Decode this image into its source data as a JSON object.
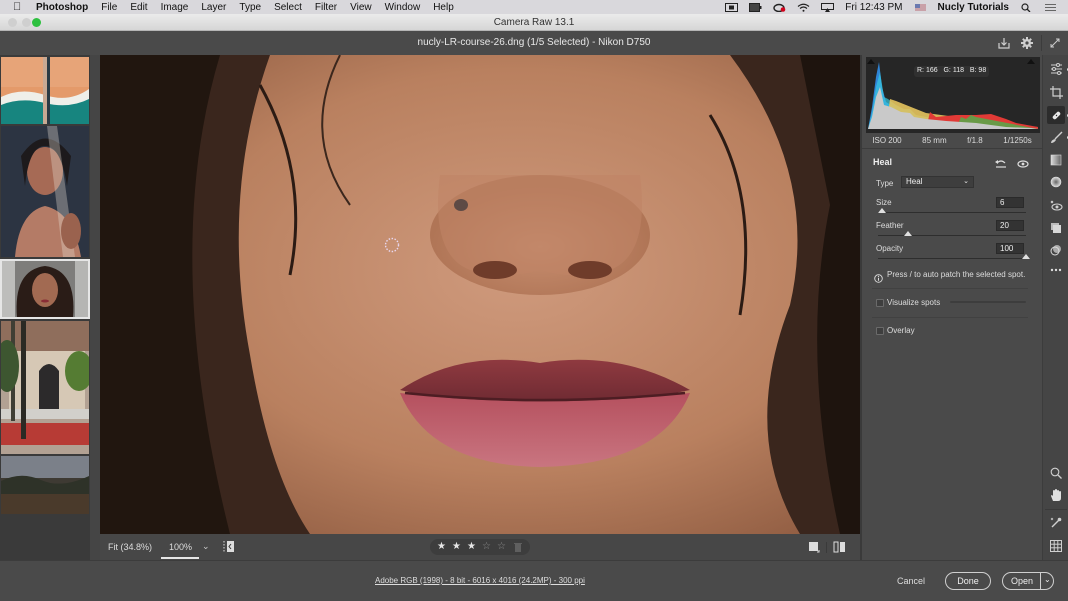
{
  "menubar": {
    "app_name": "Photoshop",
    "items": [
      "File",
      "Edit",
      "Image",
      "Layer",
      "Type",
      "Select",
      "Filter",
      "View",
      "Window",
      "Help"
    ],
    "clock": "Fri 12:43 PM",
    "user": "Nucly Tutorials",
    "status_icons": [
      "screen-record-icon",
      "battery-icon",
      "creative-cloud-icon",
      "wifi-icon",
      "airplay-icon",
      "flag-icon",
      "spotlight-icon",
      "notification-center-icon"
    ]
  },
  "window": {
    "title": "Camera Raw 13.1"
  },
  "header": {
    "file_info": "nucly-LR-course-26.dng (1/5 Selected)  -  Nikon D750"
  },
  "filmstrip": {
    "thumbnails": [
      {
        "name": "beach-aerial",
        "selected": false
      },
      {
        "name": "woman-veil-portrait",
        "selected": false
      },
      {
        "name": "woman-curly-hair-portrait",
        "selected": true
      },
      {
        "name": "palace-building",
        "selected": false
      },
      {
        "name": "mountain-landscape",
        "selected": false
      }
    ]
  },
  "histogram": {
    "rgb_readout": {
      "r_label": "R:",
      "r": "166",
      "g_label": "G:",
      "g": "118",
      "b_label": "B:",
      "b": "98"
    }
  },
  "exif": {
    "iso": "ISO 200",
    "focal_length": "85 mm",
    "aperture": "f/1.8",
    "shutter": "1/1250s"
  },
  "heal_panel": {
    "title": "Heal",
    "type_label": "Type",
    "type_value": "Heal",
    "size_label": "Size",
    "size_value": "6",
    "size_fraction": 0.03,
    "feather_label": "Feather",
    "feather_value": "20",
    "feather_fraction": 0.2,
    "opacity_label": "Opacity",
    "opacity_value": "100",
    "opacity_fraction": 1.0,
    "hint": "Press / to auto patch the selected spot.",
    "visualize_label": "Visualize spots",
    "visualize_checked": false,
    "overlay_label": "Overlay",
    "overlay_checked": false
  },
  "bottombar": {
    "fit_label": "Fit (34.8%)",
    "zoom_value": "100%",
    "rating": 3,
    "rating_max": 5
  },
  "footer": {
    "workflow_options": "Adobe RGB (1998) - 8 bit - 6016 x 4016 (24.2MP) - 300 ppi",
    "cancel_label": "Cancel",
    "done_label": "Done",
    "open_label": "Open"
  },
  "colors": {
    "accent_selected": "#e6e6e6",
    "panel_bg": "#4a4a4a",
    "traffic_green": "#2dc03f"
  }
}
